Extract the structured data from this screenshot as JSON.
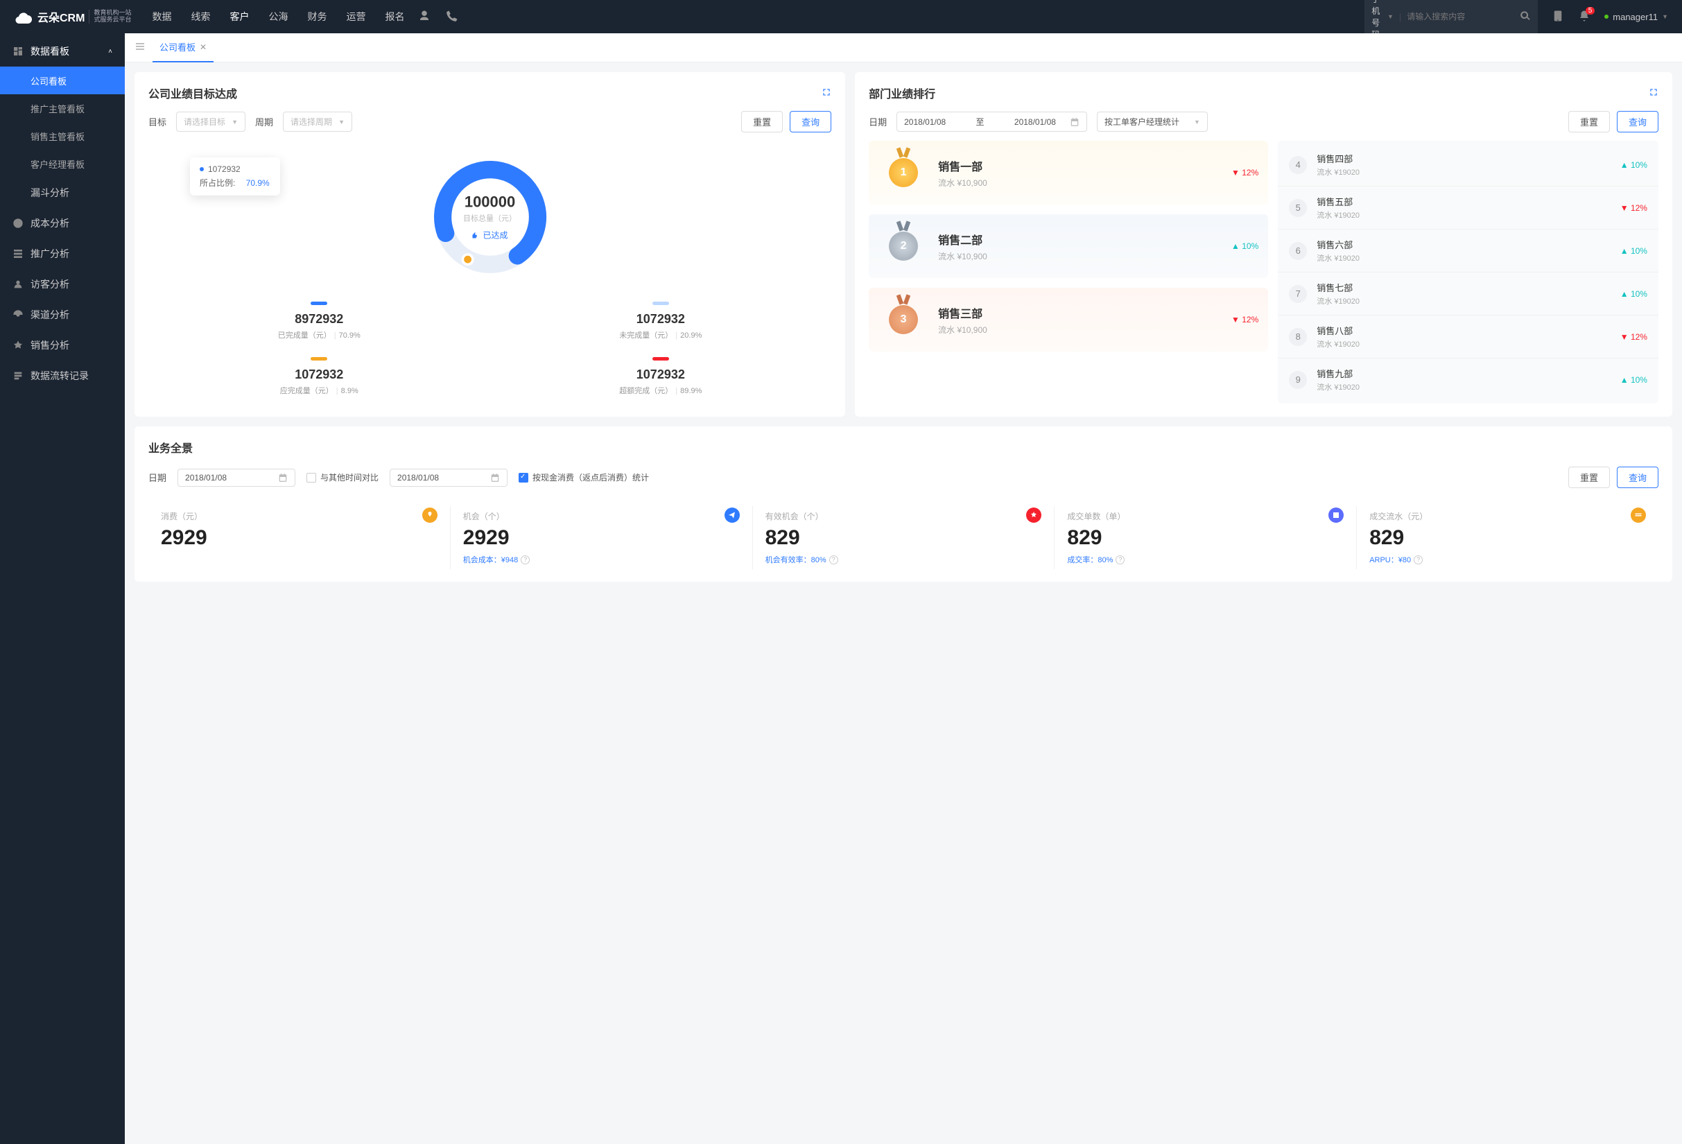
{
  "brand": {
    "main": "云朵CRM",
    "sub1": "教育机构一站",
    "sub2": "式服务云平台"
  },
  "nav": {
    "items": [
      "数据",
      "线索",
      "客户",
      "公海",
      "财务",
      "运营",
      "报名"
    ],
    "active_index": 2
  },
  "search": {
    "type": "手机号码",
    "placeholder": "请输入搜索内容"
  },
  "notifications_count": "5",
  "user": "manager11",
  "sidebar": {
    "parent": "数据看板",
    "subs": [
      "公司看板",
      "推广主管看板",
      "销售主管看板",
      "客户经理看板"
    ],
    "active_sub_index": 0,
    "items": [
      "漏斗分析",
      "成本分析",
      "推广分析",
      "访客分析",
      "渠道分析",
      "销售分析",
      "数据流转记录"
    ]
  },
  "tab": {
    "label": "公司看板"
  },
  "target_card": {
    "title": "公司业绩目标达成",
    "filter_target_label": "目标",
    "filter_target_ph": "请选择目标",
    "filter_period_label": "周期",
    "filter_period_ph": "请选择周期",
    "reset_btn": "重置",
    "query_btn": "查询",
    "tooltip_value": "1072932",
    "tooltip_ratio_label": "所占比例:",
    "tooltip_ratio": "70.9%",
    "center_value": "100000",
    "center_label": "目标总量（元）",
    "center_status": "已达成",
    "metrics": [
      {
        "color": "#2f7bff",
        "value": "8972932",
        "label": "已完成量（元）",
        "pct": "70.9%"
      },
      {
        "color": "#bcd7ff",
        "value": "1072932",
        "label": "未完成量（元）",
        "pct": "20.9%"
      },
      {
        "color": "#f5a623",
        "value": "1072932",
        "label": "应完成量（元）",
        "pct": "8.9%"
      },
      {
        "color": "#f5222d",
        "value": "1072932",
        "label": "超额完成（元）",
        "pct": "89.9%"
      }
    ]
  },
  "rank_card": {
    "title": "部门业绩排行",
    "date_label": "日期",
    "date_from": "2018/01/08",
    "date_sep": "至",
    "date_to": "2018/01/08",
    "stat_type": "按工单客户经理统计",
    "reset_btn": "重置",
    "query_btn": "查询",
    "podium": [
      {
        "rank": "1",
        "name": "销售一部",
        "sub": "流水 ¥10,900",
        "trend": "12%",
        "dir": "down"
      },
      {
        "rank": "2",
        "name": "销售二部",
        "sub": "流水 ¥10,900",
        "trend": "10%",
        "dir": "up"
      },
      {
        "rank": "3",
        "name": "销售三部",
        "sub": "流水 ¥10,900",
        "trend": "12%",
        "dir": "down"
      }
    ],
    "list": [
      {
        "rank": "4",
        "name": "销售四部",
        "sub": "流水 ¥19020",
        "trend": "10%",
        "dir": "up"
      },
      {
        "rank": "5",
        "name": "销售五部",
        "sub": "流水 ¥19020",
        "trend": "12%",
        "dir": "down"
      },
      {
        "rank": "6",
        "name": "销售六部",
        "sub": "流水 ¥19020",
        "trend": "10%",
        "dir": "up"
      },
      {
        "rank": "7",
        "name": "销售七部",
        "sub": "流水 ¥19020",
        "trend": "10%",
        "dir": "up"
      },
      {
        "rank": "8",
        "name": "销售八部",
        "sub": "流水 ¥19020",
        "trend": "12%",
        "dir": "down"
      },
      {
        "rank": "9",
        "name": "销售九部",
        "sub": "流水 ¥19020",
        "trend": "10%",
        "dir": "up"
      }
    ]
  },
  "overview": {
    "title": "业务全景",
    "date_label": "日期",
    "date1": "2018/01/08",
    "compare_label": "与其他时间对比",
    "date2": "2018/01/08",
    "check_label": "按现金消费（返点后消费）统计",
    "reset_btn": "重置",
    "query_btn": "查询",
    "kpis": [
      {
        "label": "消费（元）",
        "value": "2929",
        "foot": "",
        "color": "#f5a623"
      },
      {
        "label": "机会（个）",
        "value": "2929",
        "foot": "机会成本：¥948",
        "color": "#2f7bff"
      },
      {
        "label": "有效机会（个）",
        "value": "829",
        "foot": "机会有效率：80%",
        "color": "#f5222d"
      },
      {
        "label": "成交单数（单）",
        "value": "829",
        "foot": "成交率：80%",
        "color": "#5b6cff"
      },
      {
        "label": "成交流水（元）",
        "value": "829",
        "foot": "ARPU：¥80",
        "color": "#f5a623"
      }
    ]
  },
  "chart_data": {
    "type": "pie",
    "title": "目标总量（元）",
    "total": 100000,
    "series": [
      {
        "name": "已完成量",
        "value": 8972932,
        "pct": 70.9,
        "color": "#2f7bff"
      },
      {
        "name": "未完成量",
        "value": 1072932,
        "pct": 20.9,
        "color": "#bcd7ff"
      },
      {
        "name": "应完成量",
        "value": 1072932,
        "pct": 8.9,
        "color": "#f5a623"
      },
      {
        "name": "超额完成",
        "value": 1072932,
        "pct": 89.9,
        "color": "#f5222d"
      }
    ]
  }
}
